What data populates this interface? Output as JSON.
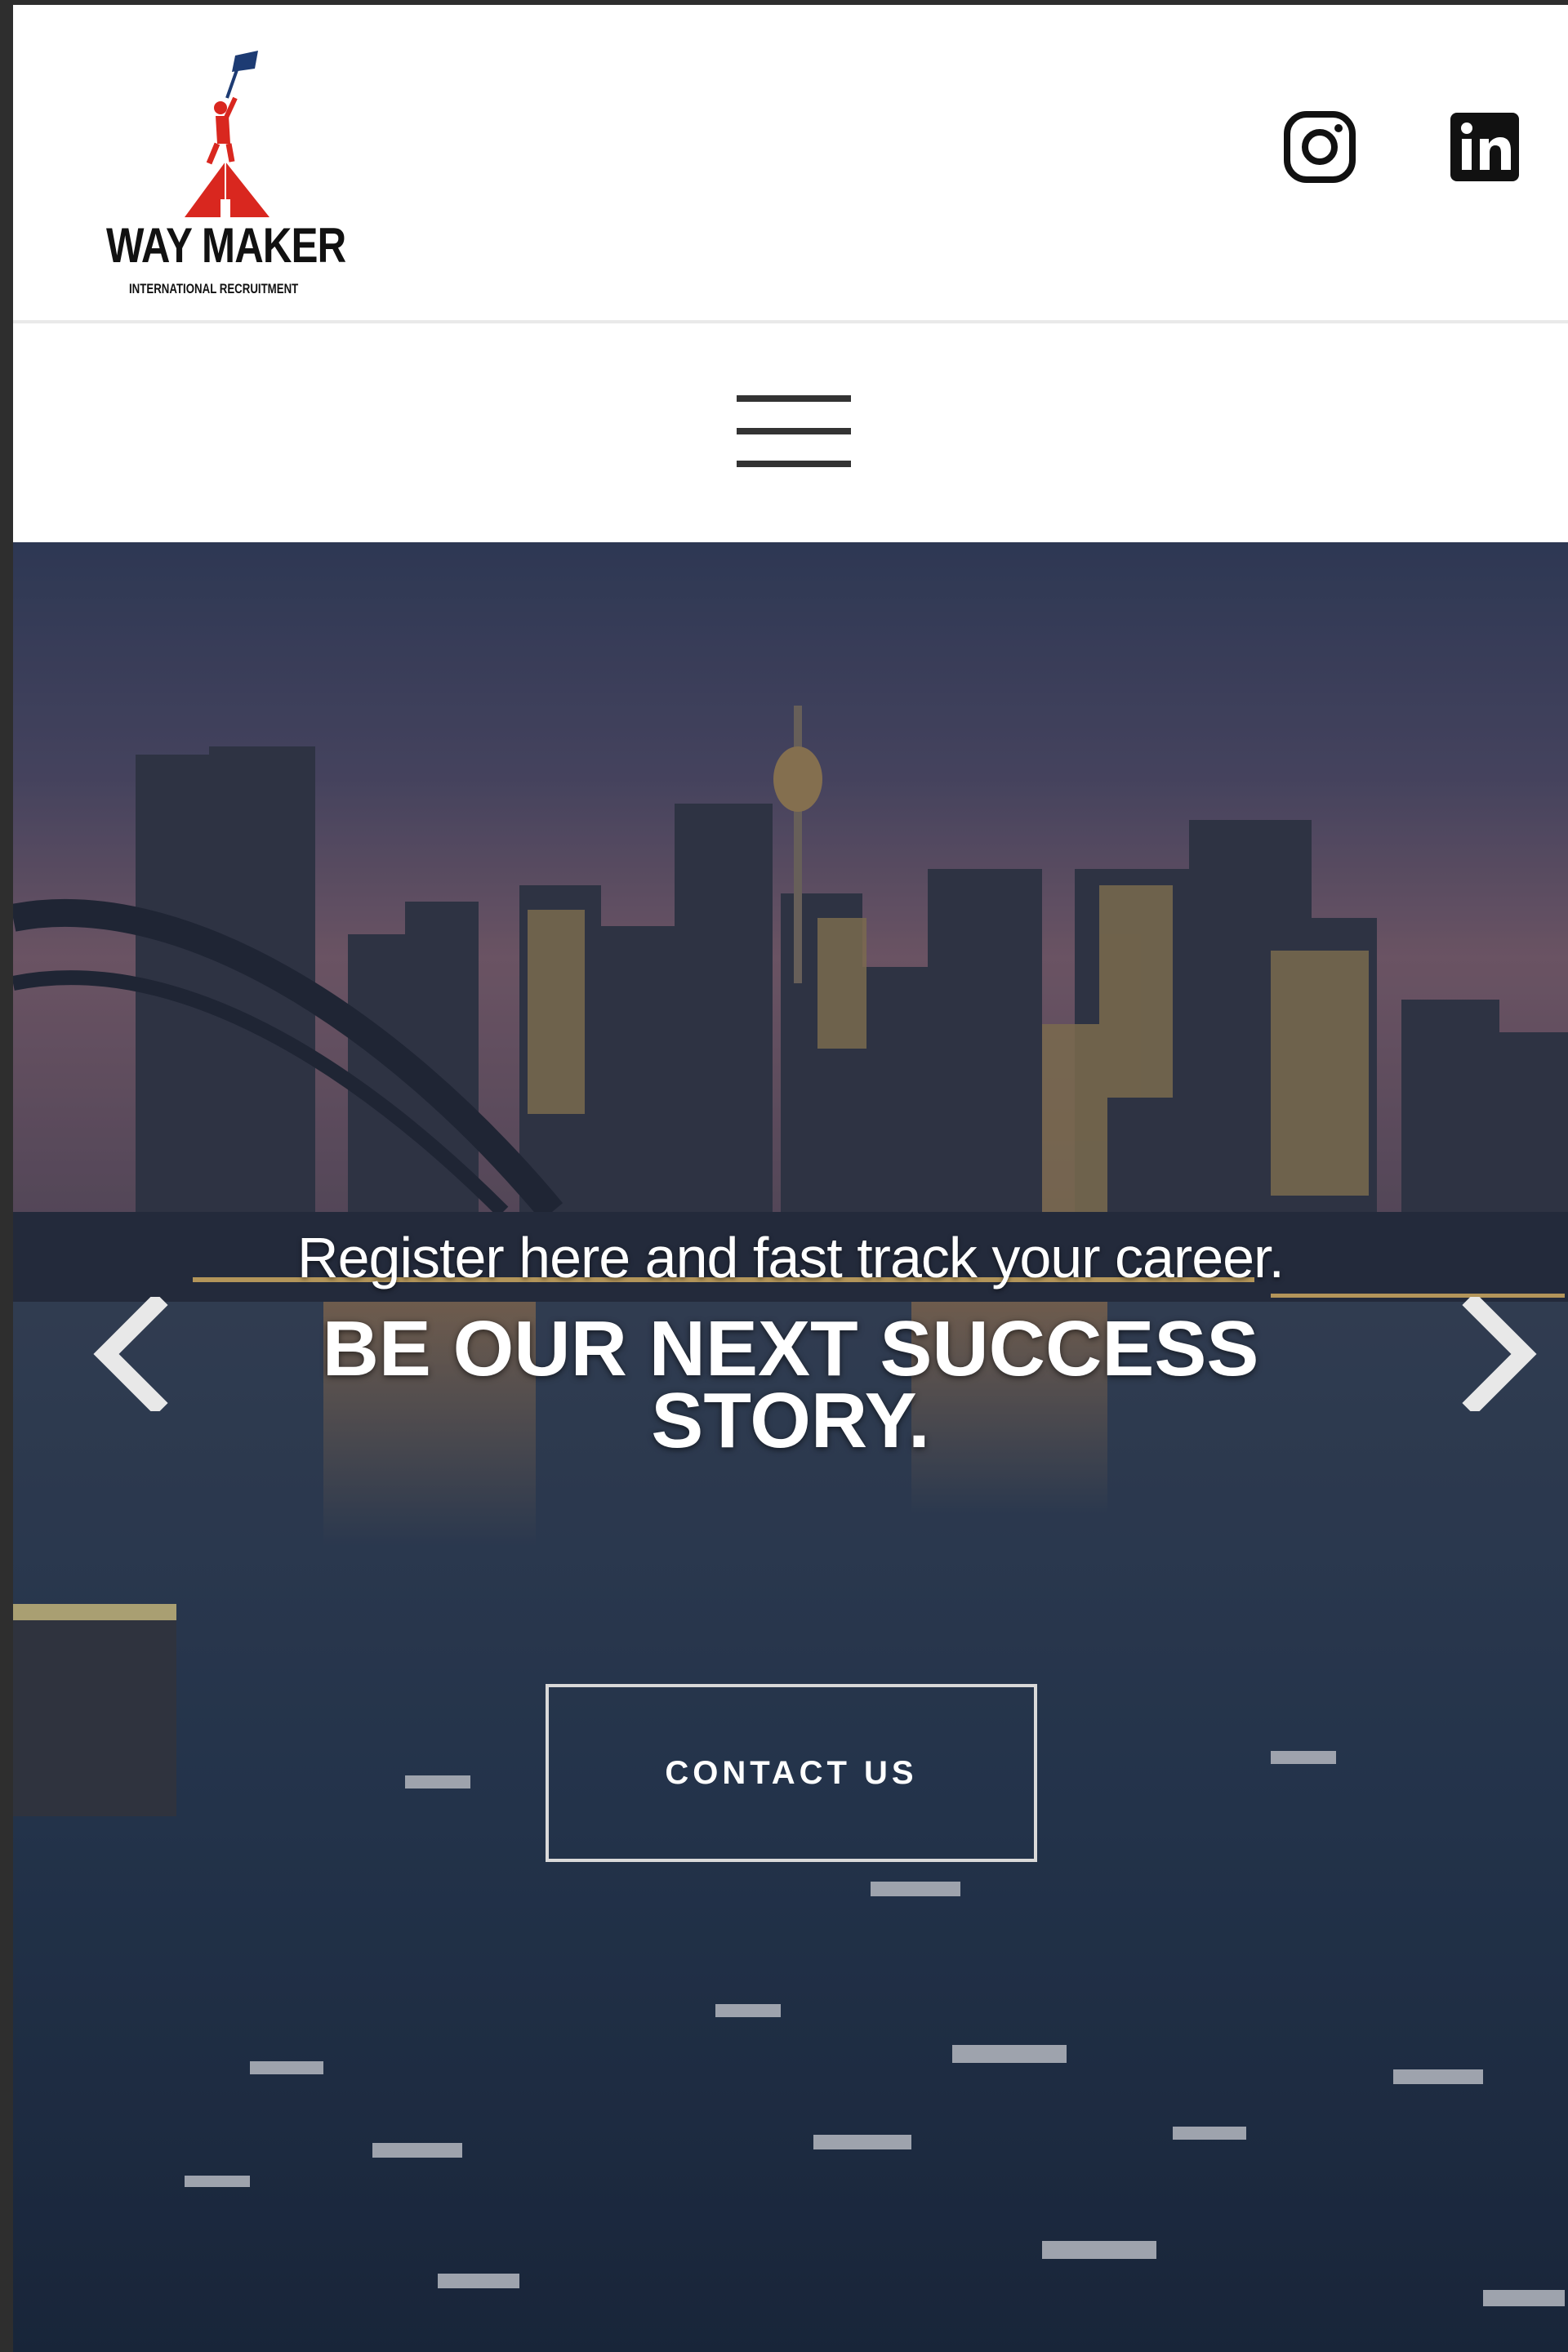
{
  "brand": {
    "name": "WAY MAKER",
    "subtitle": "INTERNATIONAL RECRUITMENT",
    "colors": {
      "red": "#d9271f",
      "flag": "#1d3b73",
      "text": "#111111"
    }
  },
  "header": {
    "social": [
      {
        "icon": "instagram-icon"
      },
      {
        "icon": "linkedin-icon"
      }
    ]
  },
  "nav": {
    "menu_icon": "hamburger-menu-icon"
  },
  "hero": {
    "tagline": "Register here and fast track your career.",
    "heading": "BE OUR NEXT SUCCESS STORY.",
    "cta_label": "CONTACT US",
    "prev_icon": "chevron-left-icon",
    "next_icon": "chevron-right-icon",
    "background": "city-harbour-skyline-photo"
  }
}
